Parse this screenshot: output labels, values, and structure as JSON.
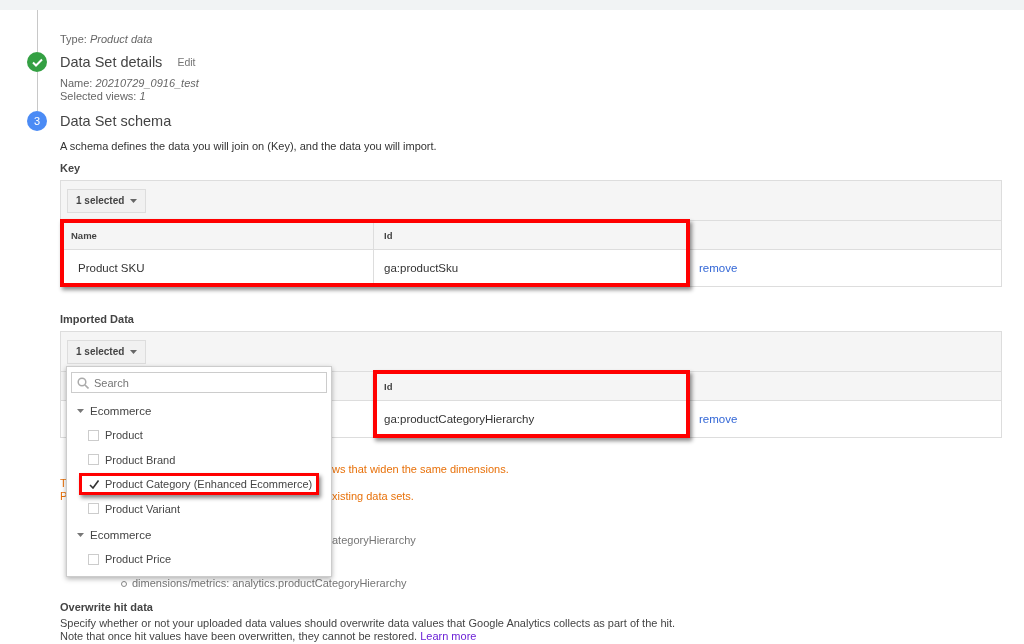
{
  "steps": [
    {
      "details": [
        "Type: *Product data*"
      ]
    },
    {
      "completed": true,
      "title": "Data Set details",
      "action": "Edit",
      "details": [
        "Name: *20210729_0916_test*",
        "Selected views: *1*"
      ]
    },
    {
      "completed": false,
      "number": "3",
      "title": "Data Set schema"
    }
  ],
  "schema": {
    "description": "A schema defines the data you will join on (Key), and the data you will import.",
    "key_table": {
      "heading": "Key",
      "selector": "1 selected",
      "columns": [
        {
          "label": "Name",
          "highlighted": true
        },
        {
          "label": "Id",
          "highlighted": true
        }
      ],
      "rows": [
        {
          "cells": [
            "Product SKU",
            "ga:productSku"
          ],
          "action": "remove"
        }
      ]
    },
    "imported_table": {
      "heading": "Imported Data",
      "selector": "1 selected",
      "columns": [
        {
          "highlighted": false
        },
        {
          "label": "Id",
          "highlighted": true
        }
      ],
      "rows": [
        {
          "cells": [
            null,
            "ga:productCategoryHierarchy"
          ],
          "action": "remove"
        }
      ],
      "dropdown": {
        "search": {
          "placeholder": "Search"
        },
        "groups": [
          {
            "label": "Ecommerce",
            "expanded": true,
            "options": [
              {
                "label": "Product",
                "checked": false,
                "highlighted": false
              },
              {
                "label": "Product Brand",
                "checked": false,
                "highlighted": false
              },
              {
                "label": "Product Category (Enhanced Ecommerce)",
                "checked": true,
                "highlighted": true
              },
              {
                "label": "Product Variant",
                "checked": false,
                "highlighted": false
              }
            ]
          },
          {
            "label": "Ecommerce",
            "expanded": true,
            "options": [
              {
                "label": "Product Price",
                "checked": false,
                "highlighted": false
              }
            ]
          }
        ]
      }
    },
    "notes": [
      {
        "kind": "warning",
        "end": "ws that widen the same dimensions."
      },
      {
        "kind": "warning",
        "start": "T"
      },
      {
        "kind": "warning",
        "start": "P",
        "end": "xisting data sets."
      },
      {
        "kind": "detail",
        "end": "ategoryHierarchy"
      },
      {
        "kind": "bullet",
        "text": "dimensions/metrics: analytics.productCategoryHierarchy"
      }
    ],
    "overwrite": {
      "heading": "Overwrite hit data",
      "lines": [
        "Specify whether or not your uploaded data values should overwrite data values that Google Analytics collects as part of the hit.",
        "Note that once hit values have been overwritten, they cannot be restored."
      ],
      "link": "Learn more"
    }
  }
}
